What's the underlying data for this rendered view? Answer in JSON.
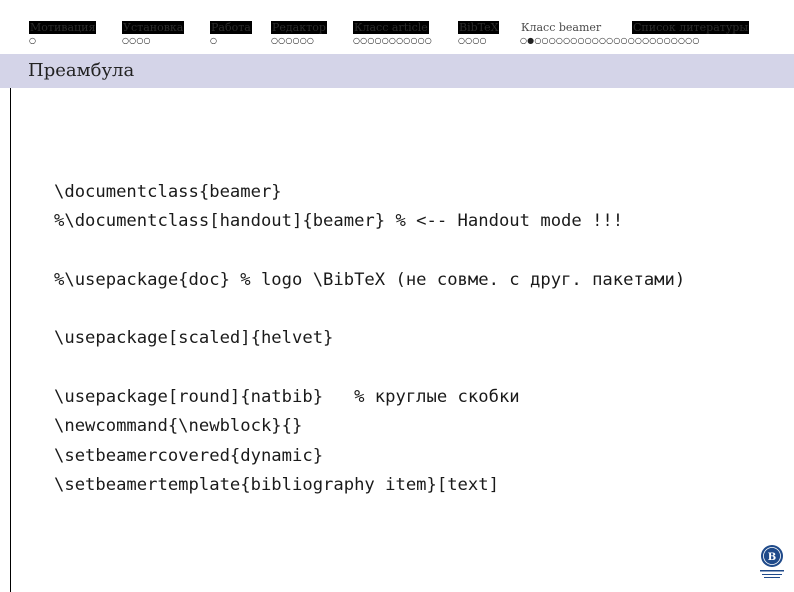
{
  "navigation": {
    "sections": [
      {
        "id": "motivation",
        "label": "Мотивация",
        "dots": "○",
        "current": false
      },
      {
        "id": "install",
        "label": "Установка",
        "dots": "○○○○",
        "current": false
      },
      {
        "id": "work",
        "label": "Работа",
        "dots": "○",
        "current": false
      },
      {
        "id": "editor",
        "label": "Редактор",
        "dots": "○○○○○○",
        "current": false
      },
      {
        "id": "article",
        "label": "Класс article",
        "dots": "○○○○○○○○○○○",
        "current": false
      },
      {
        "id": "bibtex",
        "label": "BibTeX",
        "dots": "○○○○",
        "current": false
      },
      {
        "id": "beamer",
        "label": "Класс beamer",
        "dots": "○●○○○○○○○○○○○○○○○○○○○○○○○",
        "current": true
      },
      {
        "id": "bibliography",
        "label": "Список литературы",
        "dots": "",
        "current": false
      }
    ]
  },
  "frame": {
    "title": "Преамбула",
    "code_lines": [
      "\\documentclass{beamer}",
      "%\\documentclass[handout]{beamer} % <-- Handout mode !!!",
      "",
      "%\\usepackage{doc} % logo \\BibTeX (не совме. с друг. пакетами)",
      "",
      "\\usepackage[scaled]{helvet}",
      "",
      "\\usepackage[round]{natbib}   % круглые скобки",
      "\\newcommand{\\newblock}{}",
      "\\setbeamercovered{dynamic}",
      "\\setbeamertemplate{bibliography item}[text]"
    ]
  },
  "logo": {
    "icon": "hse-university-logo-icon"
  },
  "colors": {
    "title_bar": "#d4d4e8",
    "logo_blue": "#1f4a8a",
    "text": "#1a1a1a"
  }
}
